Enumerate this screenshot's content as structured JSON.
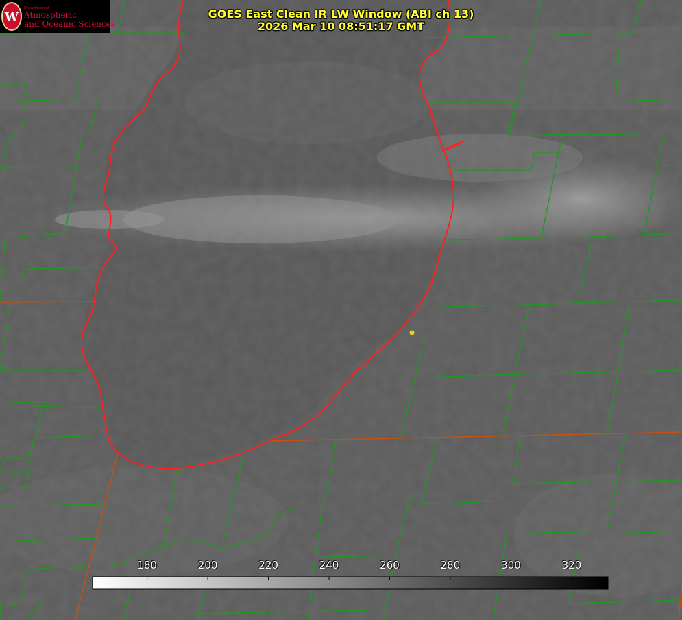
{
  "header": {
    "title_line1": "GOES East Clean IR LW Window (ABI ch 13)",
    "title_line2": "2026 Mar 10 08:51:17 GMT"
  },
  "logo": {
    "dept_label": "Department of",
    "line1": "Atmospheric",
    "line2": "and Oceanic Sciences",
    "seal_letter": "W"
  },
  "colorbar": {
    "ticks": [
      "180",
      "200",
      "220",
      "240",
      "260",
      "280",
      "300",
      "320"
    ],
    "tick_values": [
      180,
      200,
      220,
      240,
      260,
      280,
      300,
      320
    ],
    "range": [
      162,
      332
    ],
    "gradient": [
      "#ffffff",
      "#000000"
    ]
  },
  "colors": {
    "coastline": "#ff2020",
    "county_borders": "#1f9a1f",
    "state_borders": "#c85014",
    "marker": "#e6d21e"
  }
}
